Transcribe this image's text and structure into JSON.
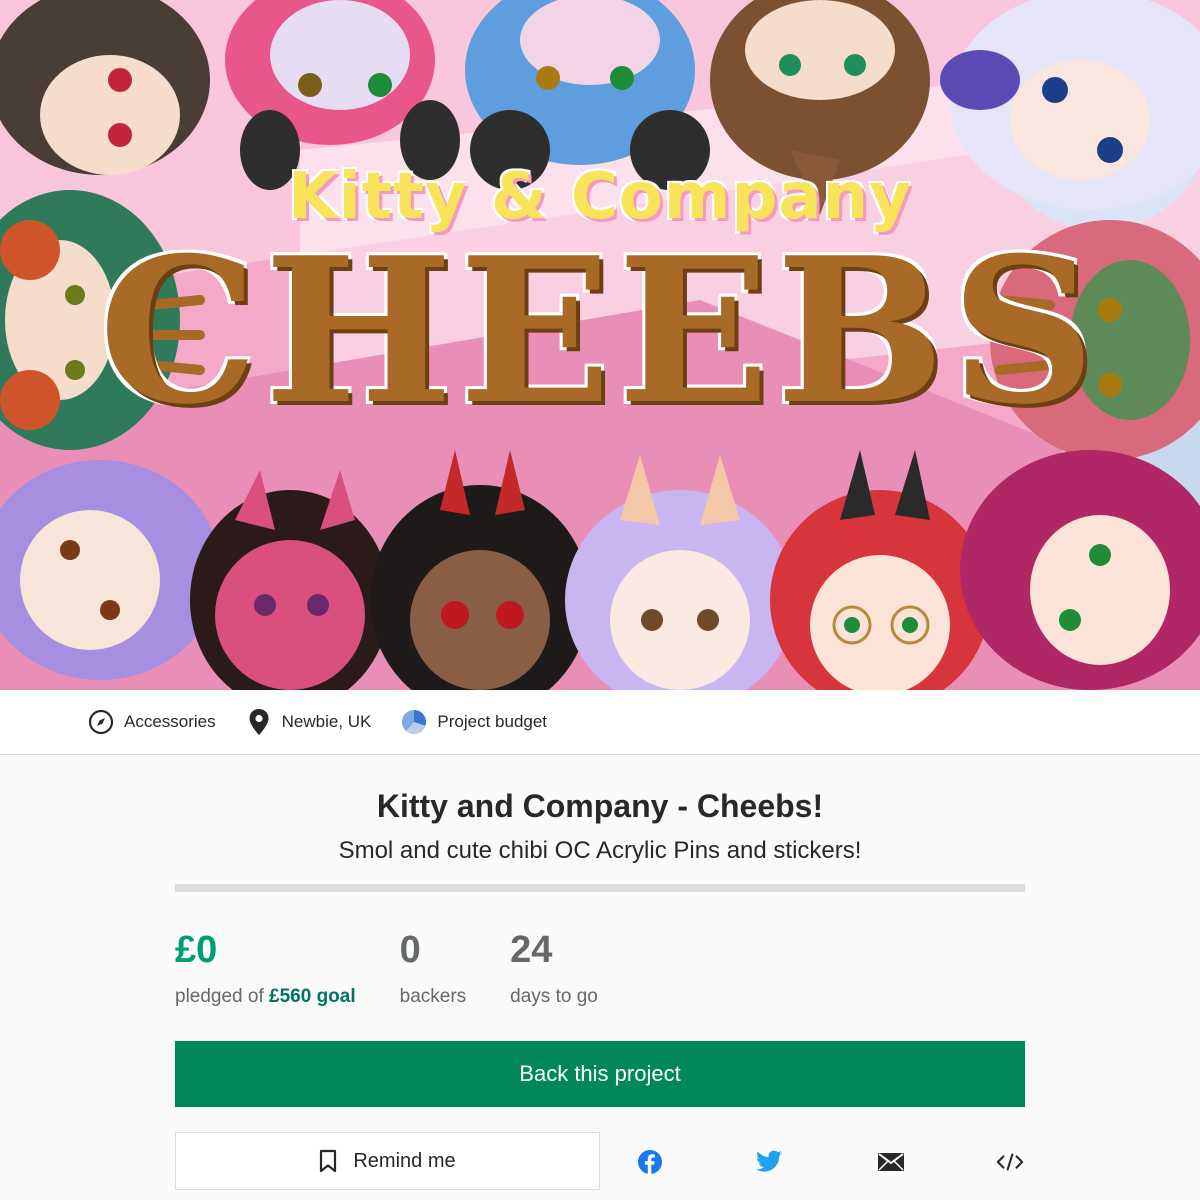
{
  "hero": {
    "subtitle": "Kitty & Company",
    "title": "CHEEBS"
  },
  "meta": {
    "category": "Accessories",
    "location": "Newbie, UK",
    "budget": "Project budget",
    "icons": [
      "compass-icon",
      "location-pin-icon",
      "pie-chart-icon"
    ]
  },
  "project": {
    "title": "Kitty and Company - Cheebs!",
    "blurb": "Smol and cute chibi OC Acrylic Pins and stickers!",
    "funded_fraction": 0
  },
  "stats": {
    "pledged_value": "£0",
    "pledged_label_prefix": "pledged of ",
    "goal": "£560 goal",
    "backers_value": "0",
    "backers_label": "backers",
    "days_value": "24",
    "days_label": "days to go"
  },
  "actions": {
    "back_label": "Back this project",
    "remind_label": "Remind me",
    "share_icons": [
      "facebook-icon",
      "twitter-icon",
      "email-icon",
      "embed-icon"
    ]
  },
  "colors": {
    "accent_green": "#028858",
    "pledged_green": "#009e74",
    "goal_green": "#037362",
    "facebook_blue": "#1877f2",
    "twitter_blue": "#1da1f2"
  }
}
